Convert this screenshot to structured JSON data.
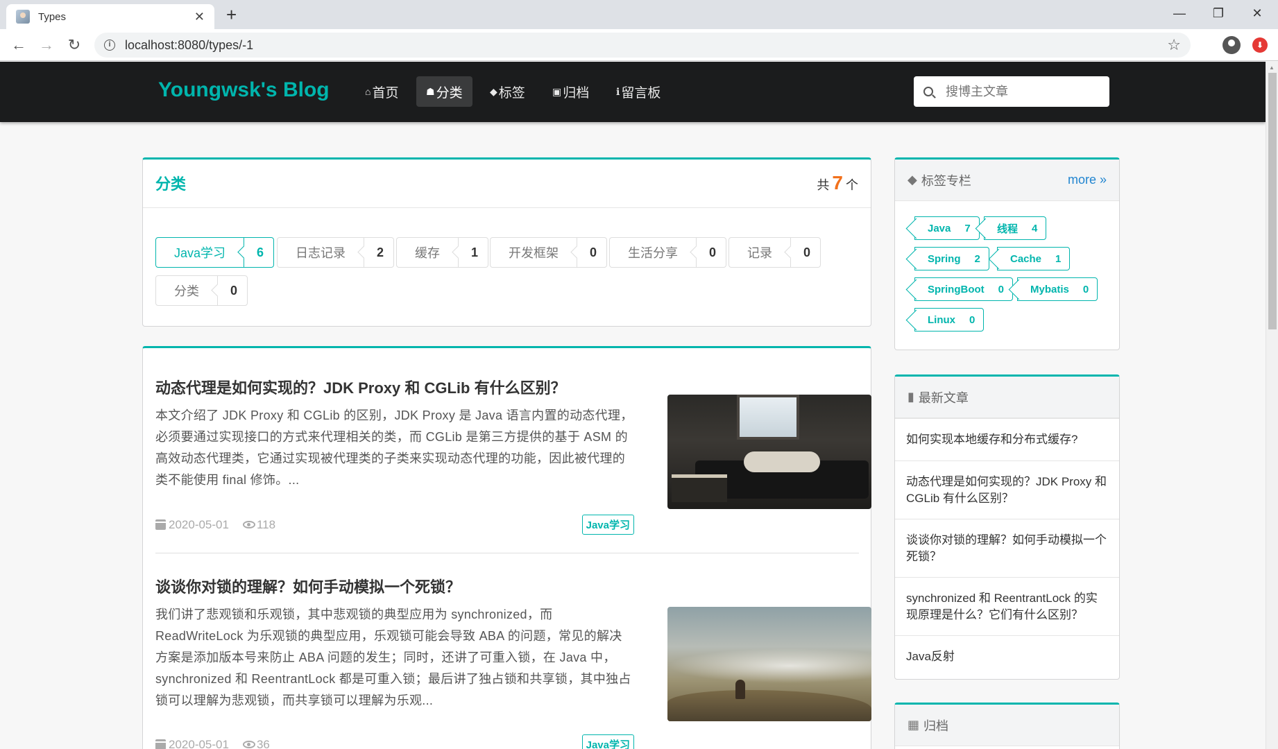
{
  "browser": {
    "tab_title": "Types",
    "tab_close": "✕",
    "new_tab": "+",
    "url": "localhost:8080/types/-1",
    "win_min": "—",
    "win_max": "❐",
    "win_close": "✕"
  },
  "site": {
    "brand": "Youngwsk's Blog",
    "menu": [
      {
        "label": "首页",
        "icon": "home-icon"
      },
      {
        "label": "分类",
        "icon": "idea-icon"
      },
      {
        "label": "标签",
        "icon": "tags-icon"
      },
      {
        "label": "归档",
        "icon": "clone-icon"
      },
      {
        "label": "留言板",
        "icon": "info-icon"
      }
    ],
    "search_placeholder": "搜博主文章"
  },
  "types": {
    "title": "分类",
    "count_prefix": "共",
    "count": "7",
    "count_suffix": "个",
    "items": [
      {
        "name": "Java学习",
        "count": "6",
        "active": true
      },
      {
        "name": "日志记录",
        "count": "2"
      },
      {
        "name": "缓存",
        "count": "1"
      },
      {
        "name": "开发框架",
        "count": "0"
      },
      {
        "name": "生活分享",
        "count": "0"
      },
      {
        "name": "记录",
        "count": "0"
      },
      {
        "name": "分类",
        "count": "0"
      }
    ]
  },
  "articles": [
    {
      "title": "动态代理是如何实现的？JDK Proxy 和 CGLib 有什么区别？",
      "desc": "本文介绍了 JDK Proxy 和 CGLib 的区别，JDK Proxy 是 Java 语言内置的动态代理，必须要通过实现接口的方式来代理相关的类，而 CGLib 是第三方提供的基于 ASM 的高效动态代理类，它通过实现被代理类的子类来实现动态代理的功能，因此被代理的类不能使用 final 修饰。...",
      "date": "2020-05-01",
      "views": "118",
      "tag": "Java学习"
    },
    {
      "title": "谈谈你对锁的理解？如何手动模拟一个死锁？",
      "desc": "我们讲了悲观锁和乐观锁，其中悲观锁的典型应用为 synchronized，而 ReadWriteLock 为乐观锁的典型应用，乐观锁可能会导致 ABA 的问题，常见的解决方案是添加版本号来防止 ABA 问题的发生；同时，还讲了可重入锁，在 Java 中，synchronized 和 ReentrantLock 都是可重入锁；最后讲了独占锁和共享锁，其中独占锁可以理解为悲观锁，而共享锁可以理解为乐观...",
      "date": "2020-05-01",
      "views": "36",
      "tag": "Java学习"
    }
  ],
  "sidebar": {
    "tags_title": "标签专栏",
    "tags_more": "more",
    "tags": [
      {
        "name": "Java",
        "count": "7"
      },
      {
        "name": "线程",
        "count": "4"
      },
      {
        "name": "Spring",
        "count": "2"
      },
      {
        "name": "Cache",
        "count": "1"
      },
      {
        "name": "SpringBoot",
        "count": "0"
      },
      {
        "name": "Mybatis",
        "count": "0"
      },
      {
        "name": "Linux",
        "count": "0"
      }
    ],
    "recent_title": "最新文章",
    "recent": [
      "如何实现本地缓存和分布式缓存?",
      "动态代理是如何实现的？JDK Proxy 和 CGLib 有什么区别？",
      "谈谈你对锁的理解？如何手动模拟一个死锁？",
      "synchronized 和 ReentrantLock 的实现原理是什么？它们有什么区别？",
      "Java反射"
    ],
    "archive_title": "归档"
  },
  "colors": {
    "accent": "#00b5ad",
    "count_highlight": "#f2711c",
    "navbar": "#1b1c1d",
    "link": "#2185d0"
  }
}
